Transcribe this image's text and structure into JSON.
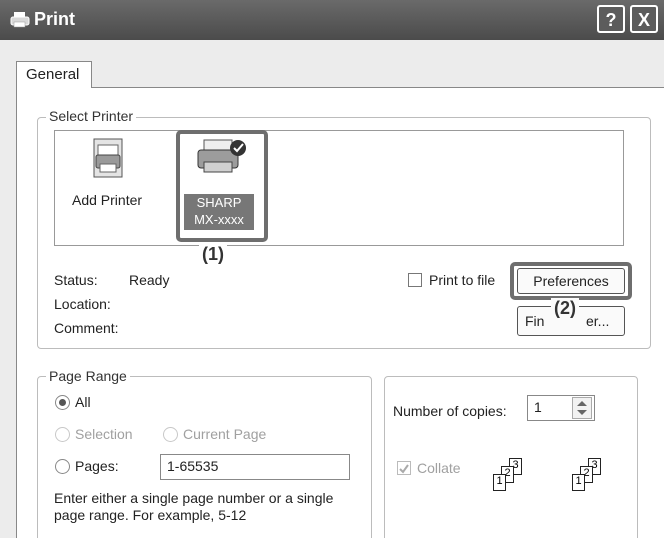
{
  "window": {
    "title": "Print",
    "help_glyph": "?",
    "close_glyph": "X"
  },
  "tabs": [
    {
      "label": "General"
    }
  ],
  "select_printer": {
    "legend": "Select Printer",
    "printers": [
      {
        "label": "Add Printer"
      },
      {
        "label_line1": "SHARP",
        "label_line2": "MX-xxxx",
        "selected": true
      }
    ],
    "callout1": "(1)",
    "status_label": "Status:",
    "status_value": "Ready",
    "location_label": "Location:",
    "comment_label": "Comment:",
    "print_to_file_label": "Print to file",
    "preferences_label": "Preferences",
    "callout2": "(2)",
    "find_printer_left": "Fin",
    "find_printer_right": "er..."
  },
  "page_range": {
    "legend": "Page Range",
    "all_label": "All",
    "selection_label": "Selection",
    "current_page_label": "Current Page",
    "pages_label": "Pages:",
    "pages_value": "1-65535",
    "hint_line1": "Enter either a single page number or a single",
    "hint_line2": "page range.  For example, 5-12"
  },
  "copies": {
    "number_label": "Number of copies:",
    "number_value": "1",
    "collate_label": "Collate",
    "collate_checked": true
  }
}
